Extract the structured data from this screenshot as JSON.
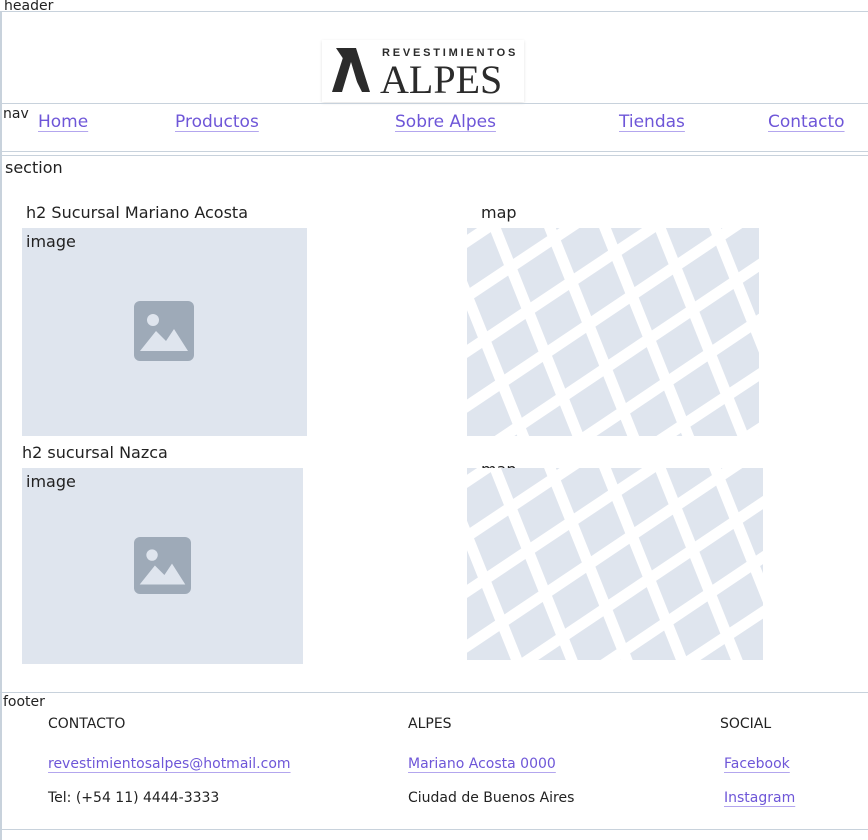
{
  "labels": {
    "header": "header",
    "nav": "nav",
    "section": "section",
    "footer": "footer",
    "image": "image",
    "map": "map"
  },
  "logo": {
    "top_text": "REVESTIMIENTOS",
    "main_text": "ALPES"
  },
  "nav": {
    "items": [
      {
        "label": "Home"
      },
      {
        "label": "Productos"
      },
      {
        "label": "Sobre Alpes"
      },
      {
        "label": "Tiendas"
      },
      {
        "label": "Contacto"
      }
    ]
  },
  "stores": [
    {
      "heading": "h2 Sucursal Mariano Acosta"
    },
    {
      "heading": "h2 sucursal Nazca"
    }
  ],
  "footer": {
    "contacto": {
      "heading": "CONTACTO",
      "email": "revestimientosalpes@hotmail.com",
      "phone": "Tel: (+54 11) 4444-3333"
    },
    "alpes": {
      "heading": "ALPES",
      "address": "Mariano Acosta 0000",
      "city": "Ciudad de Buenos Aires"
    },
    "social": {
      "heading": "SOCIAL",
      "facebook": "Facebook",
      "instagram": "Instagram"
    }
  },
  "colors": {
    "link": "#6e56d8",
    "placeholder_bg": "#dfe5ee",
    "divider": "#c8d2dc"
  }
}
